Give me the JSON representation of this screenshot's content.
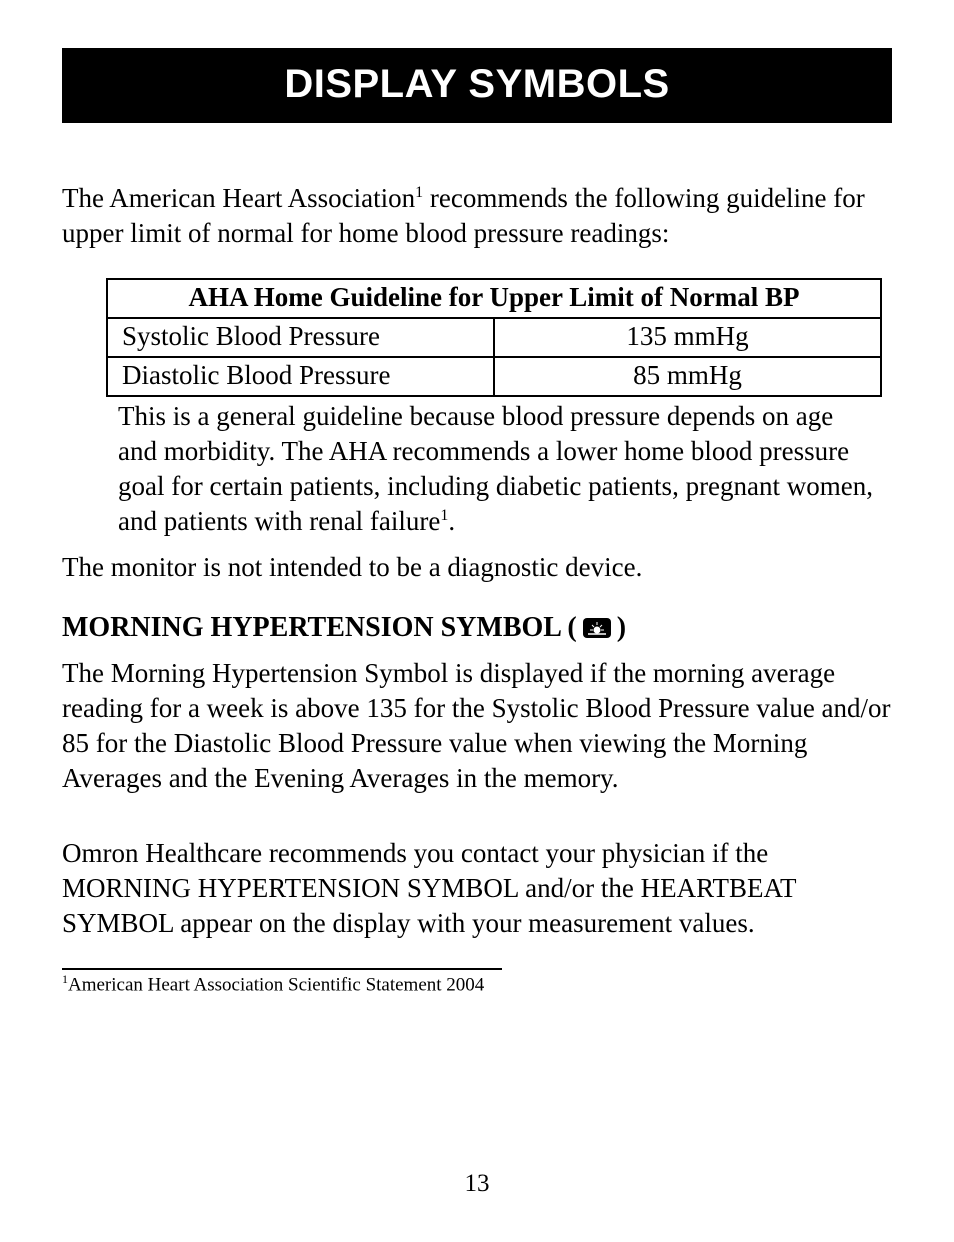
{
  "header": {
    "title": "DISPLAY SYMBOLS"
  },
  "intro": {
    "part1": "The American Heart Association",
    "sup": "1",
    "part2": " recommends the following guideline for upper limit of normal for home blood pressure readings:"
  },
  "table": {
    "caption": "AHA Home Guideline for Upper Limit of Normal BP",
    "rows": [
      {
        "label": "Systolic Blood Pressure",
        "value": "135 mmHg"
      },
      {
        "label": "Diastolic Blood Pressure",
        "value": "85 mmHg"
      }
    ]
  },
  "note": {
    "part1": "This is a general guideline because blood pressure depends on age and morbidity. The AHA recommends a lower home blood pressure goal for certain patients, including diabetic patients, pregnant women, and patients with renal failure",
    "sup": "1",
    "part2": "."
  },
  "line_diag": "The monitor is not intended to be a diagnostic device.",
  "subhead": {
    "prefix": "MORNING HYPERTENSION SYMBOL (",
    "suffix": ")"
  },
  "body1": "The Morning Hypertension Symbol is displayed if the morning average reading for a week is above 135 for the Systolic Blood Pressure value and/or 85 for the Diastolic Blood Pressure value when viewing the Morning Averages and the Evening Averages in the memory.",
  "body2": "Omron Healthcare recommends you contact your physician if the MORNING HYPERTENSION SYMBOL and/or the HEARTBEAT SYMBOL appear on the display with your measurement values.",
  "footnote": {
    "sup": "1",
    "text": "American Heart Association Scientific Statement 2004"
  },
  "page_number": "13"
}
